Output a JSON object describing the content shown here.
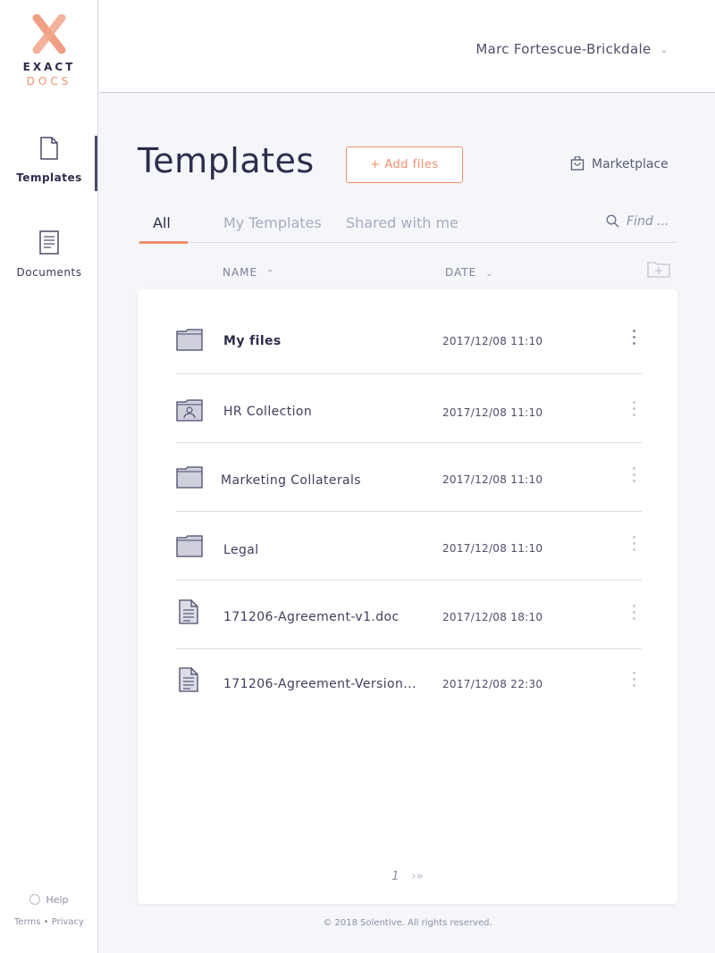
{
  "brand": {
    "line1": "EXACT",
    "line2": "DOCS",
    "accent": "#ef8f6e",
    "dark": "#2e2d4d"
  },
  "sidebar": {
    "items": [
      {
        "label": "Templates",
        "icon": "document-icon",
        "active": true
      },
      {
        "label": "Documents",
        "icon": "document-lines-icon",
        "active": false
      }
    ],
    "help_label": "Help",
    "terms_label": "Terms",
    "separator": "•",
    "privacy_label": "Privacy"
  },
  "header": {
    "user_name": "Marc Fortescue-Brickdale"
  },
  "main": {
    "title": "Templates",
    "add_button": "+ Add files",
    "marketplace": "Marketplace",
    "tabs": [
      {
        "label": "All",
        "active": true
      },
      {
        "label": "My Templates",
        "active": false
      },
      {
        "label": "Shared with me",
        "active": false
      }
    ],
    "search_placeholder": "Find ...",
    "columns": {
      "name": "NAME",
      "date": "DATE"
    }
  },
  "files": [
    {
      "name": "My files",
      "date": "2017/12/08 11:10",
      "type": "folder",
      "icon": "folder-icon"
    },
    {
      "name": "HR Collection",
      "date": "2017/12/08 11:10",
      "type": "shared-folder",
      "icon": "shared-folder-icon"
    },
    {
      "name": "Marketing Collaterals",
      "date": "2017/12/08 11:10",
      "type": "folder",
      "icon": "folder-icon"
    },
    {
      "name": "Legal",
      "date": "2017/12/08 11:10",
      "type": "folder",
      "icon": "folder-icon"
    },
    {
      "name": "171206-Agreement-v1.doc",
      "date": "2017/12/08 18:10",
      "type": "document",
      "icon": "document-icon"
    },
    {
      "name": "171206-Agreement-Version...",
      "date": "2017/12/08 22:30",
      "type": "document",
      "icon": "document-icon"
    }
  ],
  "pagination": {
    "current": "1",
    "next": "›",
    "last": "»"
  },
  "footer": {
    "copyright": "© 2018  Solentive. All rights reserved."
  }
}
